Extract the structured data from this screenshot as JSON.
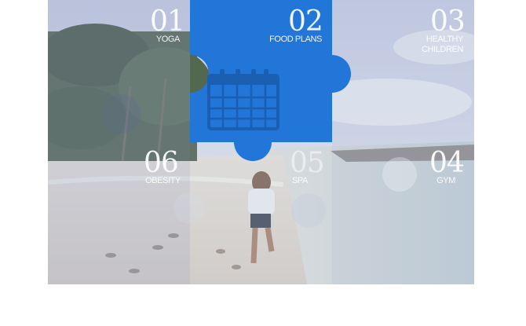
{
  "pieces": [
    {
      "num": "01",
      "label": "YOGA"
    },
    {
      "num": "02",
      "label": "FOOD PLANS"
    },
    {
      "num": "03",
      "label": "HEALTHY",
      "label2": "CHILDREN"
    },
    {
      "num": "04",
      "label": "GYM"
    },
    {
      "num": "05",
      "label": "SPA"
    },
    {
      "num": "06",
      "label": "OBESITY"
    }
  ],
  "colors": {
    "active": "#2176d8",
    "overlay": "#8f9ec2",
    "sky": "#dfe4ef",
    "sand": "#e2dcd6",
    "sea": "#c9d6dc"
  },
  "icons": {
    "active_piece": "calendar-icon"
  }
}
